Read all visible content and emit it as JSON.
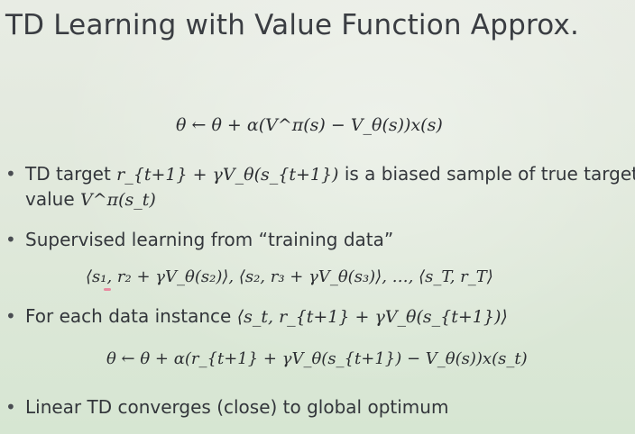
{
  "slide": {
    "title": "TD Learning with Value Function Approx.",
    "main_equation": "θ ← θ + α(V^π(s) − V_θ(s))x(s)",
    "bullets": [
      {
        "text_before": "TD target",
        "math": "r_{t+1} + γV_θ(s_{t+1})",
        "text_after": "is a biased sample of true target",
        "continuation_text": "value",
        "continuation_math": "V^π(s_t)"
      },
      {
        "text": "Supervised learning from “training data”",
        "equation": "⟨s₁, r₂ + γV_θ(s₂)⟩, ⟨s₂, r₃ + γV_θ(s₃)⟩, …, ⟨s_T, r_T⟩"
      },
      {
        "text": "For each data instance",
        "math": "⟨s_t, r_{t+1} + γV_θ(s_{t+1})⟩",
        "equation": "θ ← θ + α(r_{t+1} + γV_θ(s_{t+1}) − V_θ(s))x(s_t)"
      },
      {
        "text": "Linear TD converges (close) to global optimum"
      }
    ]
  }
}
